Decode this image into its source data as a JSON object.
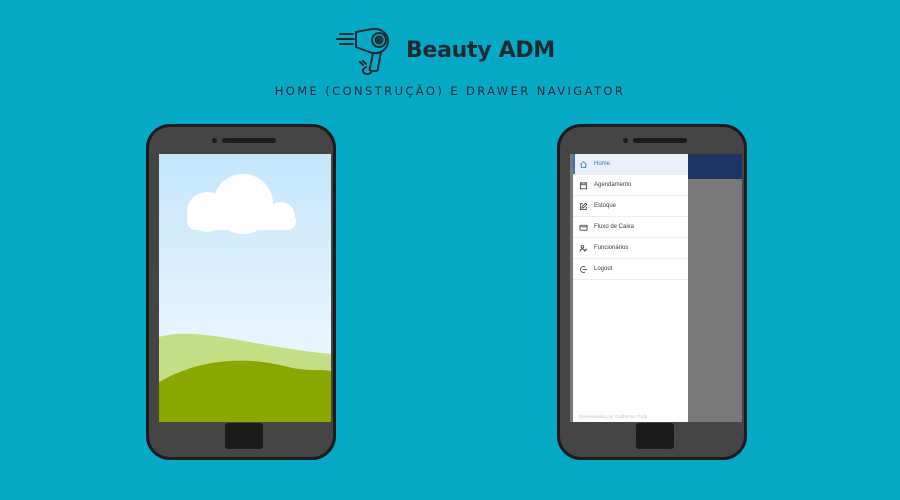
{
  "header": {
    "brand_title": "Beauty ADM",
    "subtitle": "HOME (CONSTRUÇÃO) E DRAWER NAVIGATOR"
  },
  "drawer": {
    "items": [
      {
        "label": "Home",
        "icon": "home-icon",
        "active": true
      },
      {
        "label": "Agendamento",
        "icon": "calendar-icon",
        "active": false
      },
      {
        "label": "Estoque",
        "icon": "edit-icon",
        "active": false
      },
      {
        "label": "Fluxo de Caixa",
        "icon": "credit-card-icon",
        "active": false
      },
      {
        "label": "Funcionários",
        "icon": "users-icon",
        "active": false
      },
      {
        "label": "Logout",
        "icon": "logout-icon",
        "active": false
      }
    ],
    "footer": "Desenvolvido por Guilherme Trufa"
  },
  "colors": {
    "background": "#05a9c6",
    "drawer_header": "#1e3463",
    "active_accent": "#3b6fd0"
  }
}
